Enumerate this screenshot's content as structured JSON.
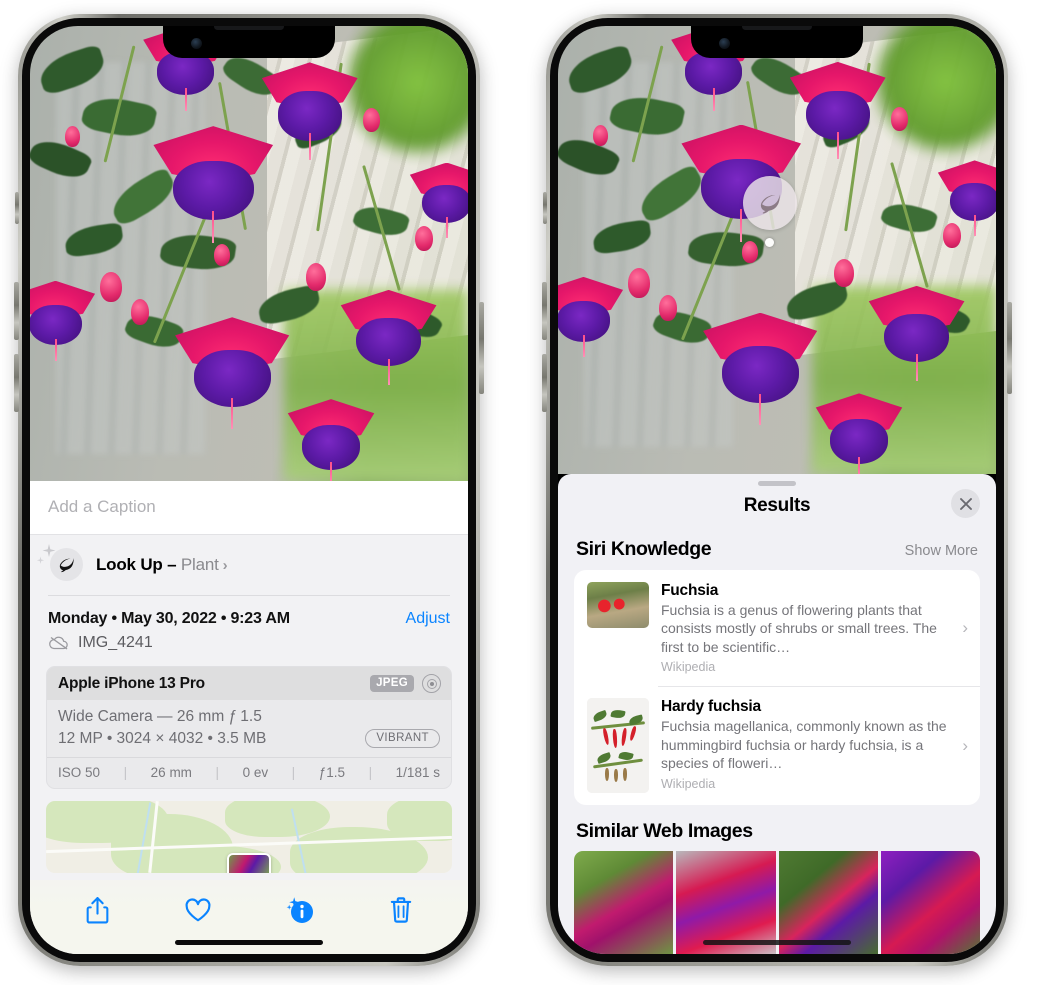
{
  "left_phone": {
    "caption": {
      "placeholder": "Add a Caption",
      "value": ""
    },
    "lookup": {
      "label": "Look Up – ",
      "subject": "Plant",
      "icon": "leaf-icon",
      "chevron": "›"
    },
    "date": {
      "text": "Monday • May 30, 2022 • 9:23 AM",
      "adjust_label": "Adjust"
    },
    "file": {
      "name": "IMG_4241",
      "icon": "icloud-slash-icon"
    },
    "camera_card": {
      "model": "Apple iPhone 13 Pro",
      "format_badge": "JPEG",
      "hdr_icon": "bullseye-icon",
      "lens_line": "Wide Camera — 26 mm ƒ 1.5",
      "spec_line": "12 MP • 3024 × 4032 • 3.5 MB",
      "style_badge": "VIBRANT",
      "exif": [
        "ISO 50",
        "26 mm",
        "0 ev",
        "ƒ1.5",
        "1/181 s"
      ]
    },
    "toolbar": [
      {
        "name": "share-button",
        "icon": "share-icon"
      },
      {
        "name": "favorite-button",
        "icon": "heart-icon"
      },
      {
        "name": "info-button",
        "icon": "info-sparkle-icon"
      },
      {
        "name": "delete-button",
        "icon": "trash-icon"
      }
    ]
  },
  "right_phone": {
    "badge": {
      "icon": "leaf-icon"
    },
    "sheet": {
      "title": "Results",
      "close_label": "✕",
      "sections": {
        "siri_knowledge": {
          "title": "Siri Knowledge",
          "action": "Show More",
          "cards": [
            {
              "title": "Fuchsia",
              "description": "Fuchsia is a genus of flowering plants that consists mostly of shrubs or small trees. The first to be scientific…",
              "source": "Wikipedia",
              "chevron": "›",
              "thumb": "fuchsia-thumbnail"
            },
            {
              "title": "Hardy fuchsia",
              "description": "Fuchsia magellanica, commonly known as the hummingbird fuchsia or hardy fuchsia, is a species of floweri…",
              "source": "Wikipedia",
              "chevron": "›",
              "thumb": "hardy-fuchsia-thumbnail"
            }
          ]
        },
        "similar_web_images": {
          "title": "Similar Web Images",
          "images": [
            "web-image-1",
            "web-image-2",
            "web-image-3",
            "web-image-4"
          ]
        }
      }
    }
  },
  "colors": {
    "accent_blue": "#0a84ff",
    "panel_gray": "#f2f2f4",
    "sheet_gray": "#f1f1f5",
    "muted_text": "#8a8a8e"
  }
}
